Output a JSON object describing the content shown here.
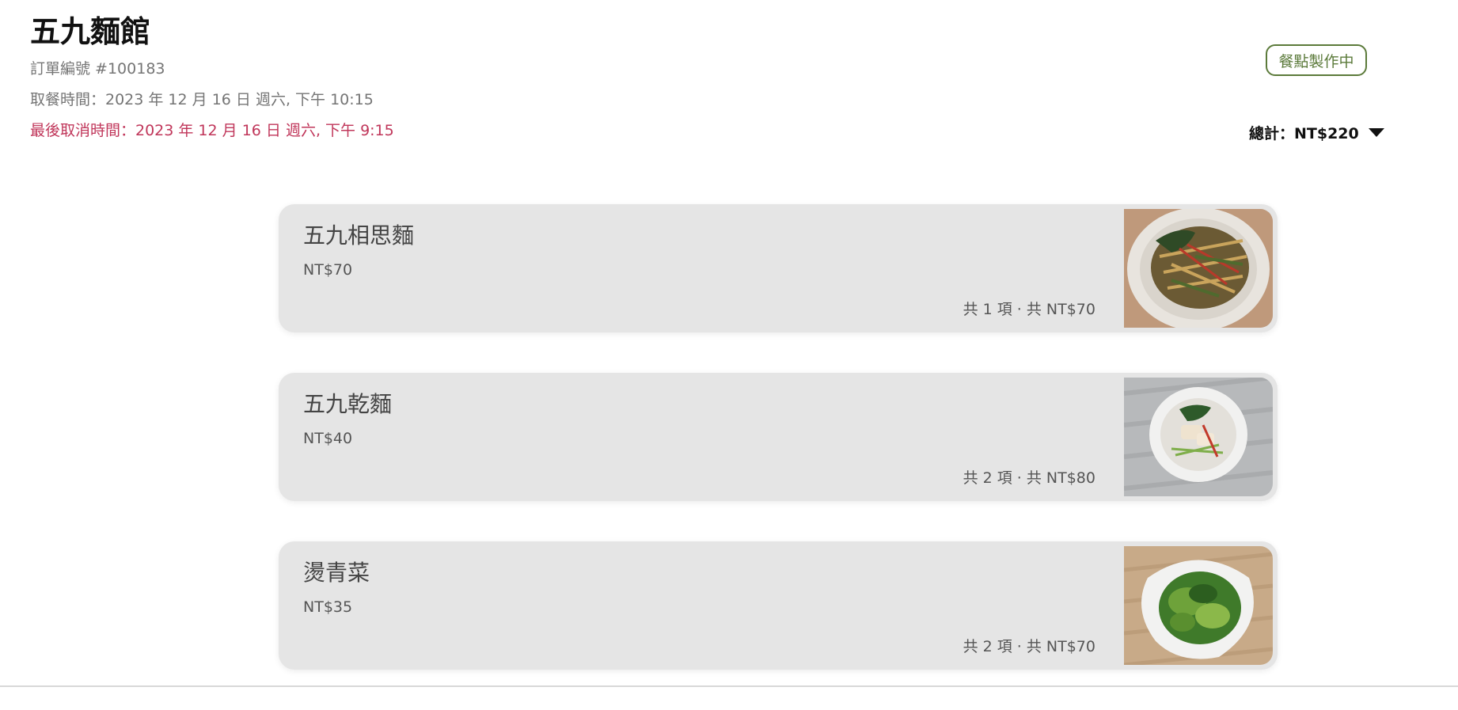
{
  "header": {
    "shop_name": "五九麵館",
    "order_number": "訂單編號 #100183",
    "pickup_time": "取餐時間：2023 年 12 月 16 日 週六, 下午 10:15",
    "cancel_deadline": "最後取消時間：2023 年 12 月 16 日 週六, 下午 9:15"
  },
  "status": {
    "label": "餐點製作中",
    "color": "#5b7a3a"
  },
  "total": {
    "label": "總計：NT$220",
    "icon": "caret-down-icon"
  },
  "items": [
    {
      "name": "五九相思麵",
      "price": "NT$70",
      "summary": "共 1 項 · 共 NT$70",
      "photo": "noodle-salad-photo"
    },
    {
      "name": "五九乾麵",
      "price": "NT$40",
      "summary": "共 2 項 · 共 NT$80",
      "photo": "dry-noodle-photo"
    },
    {
      "name": "燙青菜",
      "price": "NT$35",
      "summary": "共 2 項 · 共 NT$70",
      "photo": "boiled-greens-photo"
    }
  ],
  "colors": {
    "cancel_text": "#c0365a",
    "card_background": "#e5e5e5"
  }
}
